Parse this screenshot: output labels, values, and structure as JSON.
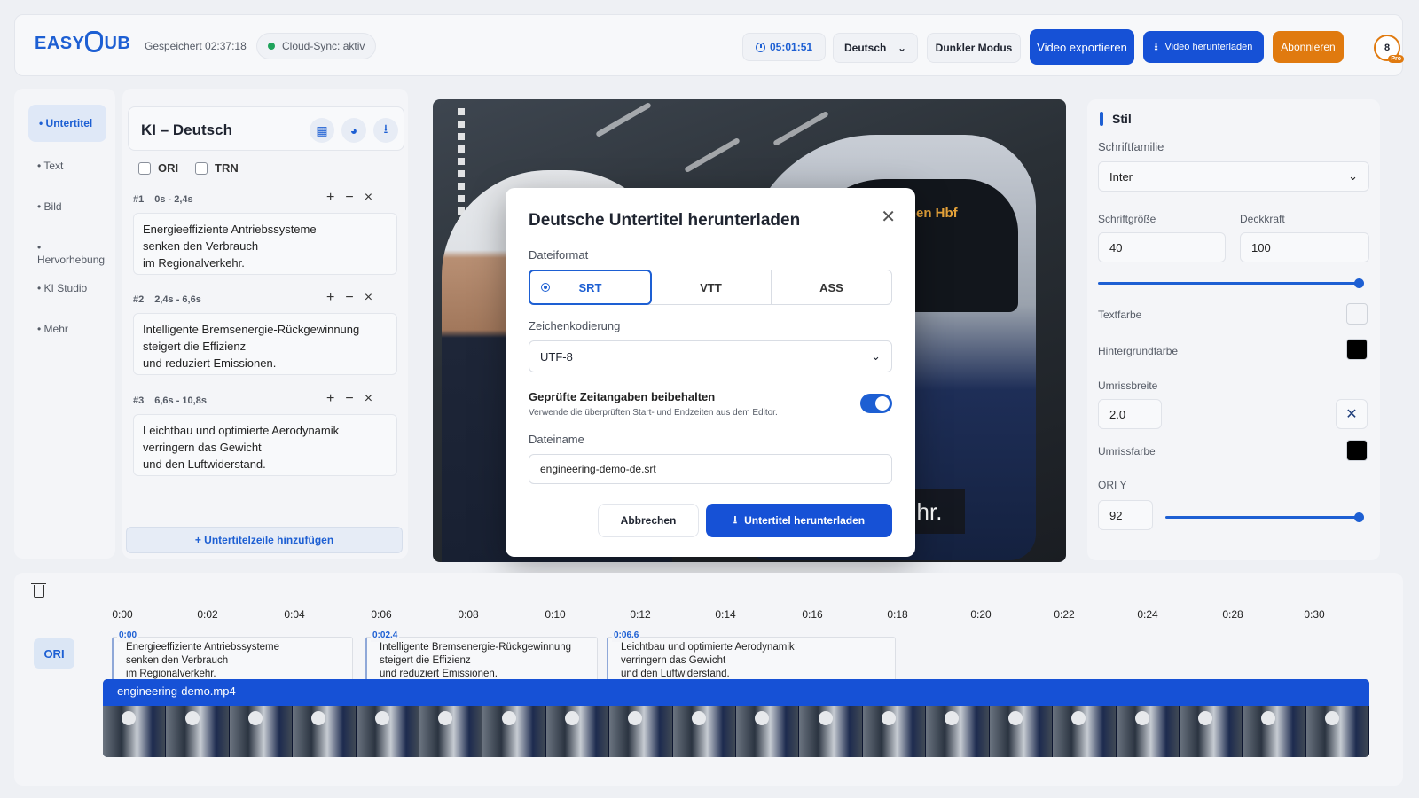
{
  "header": {
    "logo": "EASYSUB",
    "saved_label": "Gespeichert 02:37:18",
    "sync_label": "Cloud-Sync: aktiv",
    "timer": "05:01:51",
    "language": "Deutsch",
    "dark_mode_label": "Dunkler Modus",
    "export_label": "Video exportieren",
    "download_label": "Video herunterladen",
    "subscribe_label": "Abonnieren",
    "avatar_count": "8",
    "avatar_badge": "Pro",
    "accent": "#1651d6",
    "subscribe_color": "#e07a0f"
  },
  "nav": {
    "items": [
      {
        "label": "• Untertitel",
        "active": true
      },
      {
        "label": "• Text"
      },
      {
        "label": "• Bild"
      },
      {
        "label": "• Hervorhebung"
      },
      {
        "label": "• KI Studio"
      },
      {
        "label": "• Mehr"
      }
    ]
  },
  "subtitles": {
    "title": "KI – Deutsch",
    "icons": [
      "grid-icon",
      "palette-icon",
      "download-icon"
    ],
    "checkbox_ori": "ORI",
    "checkbox_trn": "TRN",
    "entries": [
      {
        "index": "#1",
        "time": "0s - 2,4s",
        "lines": [
          "Energieeffiziente Antriebssysteme",
          "senken den Verbrauch",
          "im Regionalverkehr."
        ]
      },
      {
        "index": "#2",
        "time": "2,4s - 6,6s",
        "lines": [
          "Intelligente Bremsenergie-Rückgewinnung",
          "steigert die Effizienz",
          "und reduziert Emissionen."
        ]
      },
      {
        "index": "#3",
        "time": "6,6s - 10,8s",
        "lines": [
          "Leichtbau und optimierte Aerodynamik",
          "verringern das Gewicht",
          "und den Luftwiderstand."
        ]
      }
    ],
    "add_line_label": "+ Untertitelzeile hinzufügen"
  },
  "video": {
    "destination": "RB 27    München Hbf",
    "caption_fragment": "hr."
  },
  "modal": {
    "title": "Deutsche Untertitel herunterladen",
    "format_label": "Dateiformat",
    "formats": [
      "SRT",
      "VTT",
      "ASS"
    ],
    "selected_format": "SRT",
    "encoding_label": "Zeichenkodierung",
    "encoding_value": "UTF-8",
    "toggle_title": "Geprüfte Zeitangaben beibehalten",
    "toggle_desc": "Verwende die überprüften Start- und Endzeiten aus dem Editor.",
    "toggle_on": true,
    "filename_label": "Dateiname",
    "filename_value": "engineering-demo-de.srt",
    "cancel_label": "Abbrechen",
    "download_label": "Untertitel herunterladen"
  },
  "style_panel": {
    "title": "Stil",
    "font_family_label": "Schriftfamilie",
    "font_family_value": "Inter",
    "font_size_label": "Schriftgröße",
    "font_size_value": "40",
    "opacity_label": "Deckkraft",
    "opacity_value": "100",
    "opacity_fraction": 1.0,
    "text_color_label": "Textfarbe",
    "text_color": "#f4f5f8",
    "bg_color_label": "Hintergrundfarbe",
    "bg_color": "#000000",
    "outline_width_label": "Umrissbreite",
    "outline_width_value": "2.0",
    "outline_color_label": "Umrissfarbe",
    "outline_color": "#000000",
    "ori_y_label": "ORI Y",
    "ori_y_value": "92",
    "ori_y_fraction": 0.98
  },
  "timeline": {
    "ticks": [
      "0:00",
      "0:02",
      "0:04",
      "0:06",
      "0:08",
      "0:10",
      "0:12",
      "0:14",
      "0:16",
      "0:18",
      "0:20",
      "0:22",
      "0:24",
      "0:28",
      "0:30"
    ],
    "track_label": "ORI",
    "clips": [
      {
        "start": "0:00",
        "lines": [
          "Energieeffiziente Antriebssysteme",
          "senken den Verbrauch",
          "im Regionalverkehr."
        ]
      },
      {
        "start": "0:02.4",
        "lines": [
          "Intelligente Bremsenergie-Rückgewinnung",
          "steigert die Effizienz",
          "und reduziert Emissionen."
        ]
      },
      {
        "start": "0:06.6",
        "lines": [
          "Leichtbau und optimierte Aerodynamik",
          "verringern das Gewicht",
          "und den Luftwiderstand."
        ]
      }
    ],
    "video_file": "engineering-demo.mp4"
  }
}
